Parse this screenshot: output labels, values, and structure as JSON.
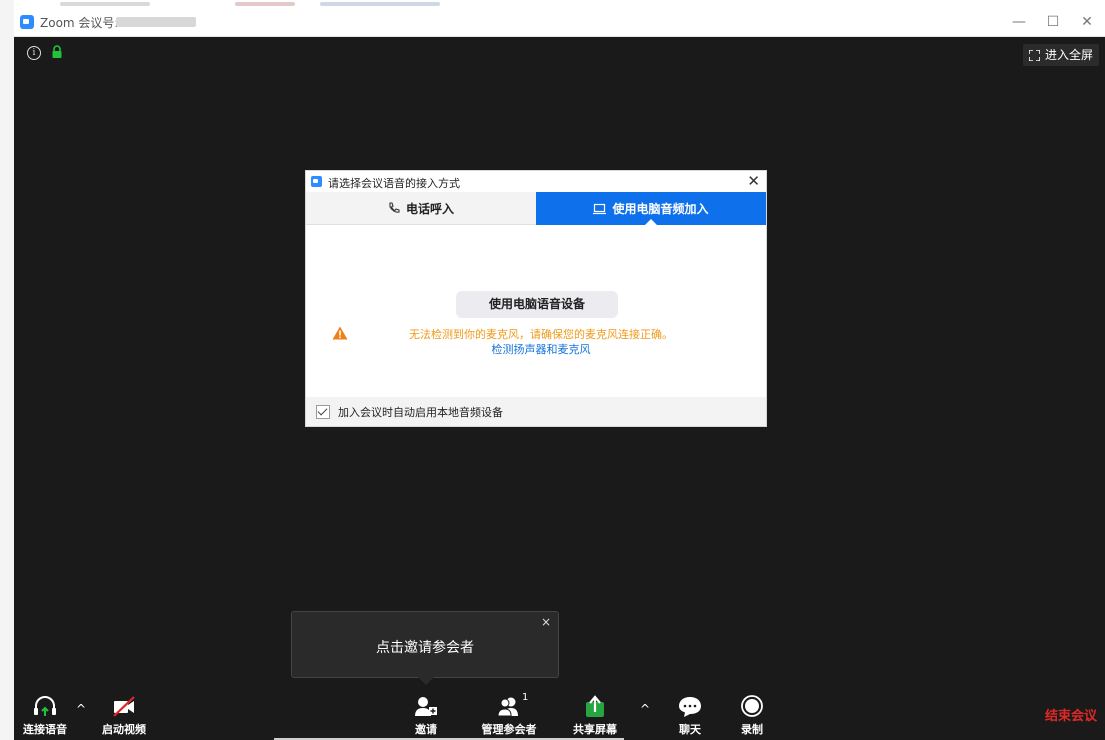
{
  "window": {
    "title": "Zoom 会议号: ",
    "controls": {
      "minimize": "—",
      "maximize": "☐",
      "close": "✕"
    }
  },
  "video": {
    "fullscreen_label": "进入全屏"
  },
  "dialog": {
    "title": "请选择会议语音的接入方式",
    "close": "✕",
    "tabs": [
      {
        "label": "电话呼入",
        "icon": "phone-icon",
        "active": false
      },
      {
        "label": "使用电脑音频加入",
        "icon": "computer-icon",
        "active": true
      }
    ],
    "use_device_button": "使用电脑语音设备",
    "warning_text": "无法检测到你的麦克风，请确保您的麦克风连接正确。",
    "test_link": "检测扬声器和麦克风",
    "auto_join_label": "加入会议时自动启用本地音频设备",
    "auto_join_checked": true
  },
  "tooltip": {
    "text": "点击邀请参会者",
    "close": "×"
  },
  "toolbar": {
    "audio_label": "连接语音",
    "video_label": "启动视频",
    "invite_label": "邀请",
    "participants_label": "管理参会者",
    "participants_count": "1",
    "share_label": "共享屏幕",
    "chat_label": "聊天",
    "record_label": "录制",
    "end_label": "结束会议",
    "caret": "^"
  },
  "colors": {
    "accent": "#0e71eb",
    "warning": "#f09a18",
    "link": "#1673d8",
    "end": "#e02828",
    "share": "#26a541",
    "background": "#1a1a1a"
  }
}
